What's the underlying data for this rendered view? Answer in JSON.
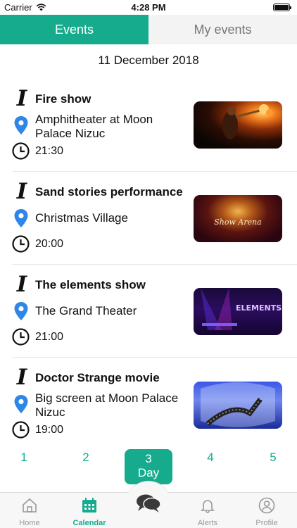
{
  "status_bar": {
    "carrier": "Carrier",
    "time": "4:28 PM"
  },
  "tabs": [
    {
      "label": "Events",
      "active": true
    },
    {
      "label": "My events",
      "active": false
    }
  ],
  "date": "11 December 2018",
  "events": [
    {
      "title": "Fire show",
      "location": "Amphitheater at Moon Palace Nizuc",
      "time": "21:30",
      "image": "fire-performer-photo"
    },
    {
      "title": "Sand stories performance",
      "location": "Christmas Village",
      "time": "20:00",
      "image": "show-arena-poster"
    },
    {
      "title": "The elements show",
      "location": "The Grand Theater",
      "time": "21:00",
      "image": "elements-show-poster"
    },
    {
      "title": "Doctor Strange movie",
      "location": "Big screen at Moon Palace Nizuc",
      "time": "19:00",
      "image": "film-reel-illustration"
    }
  ],
  "thumb_text": {
    "sand": "Show Arena",
    "elements": "ELEMENTS"
  },
  "day_picker": {
    "days": [
      "1",
      "2",
      "4",
      "5"
    ],
    "active_number": "3",
    "active_label": "Day"
  },
  "tabbar": {
    "home": "Home",
    "calendar": "Calendar",
    "alerts": "Alerts",
    "profile": "Profile",
    "active": "calendar"
  },
  "colors": {
    "accent": "#17ab8e",
    "pin": "#2e86e8",
    "inactive_tab_bg": "#f3f3f3"
  }
}
